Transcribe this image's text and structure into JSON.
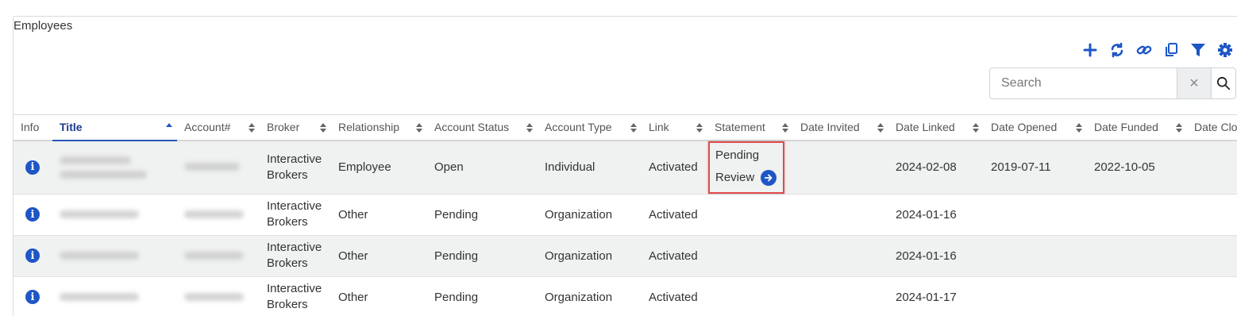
{
  "panel": {
    "title": "Employees"
  },
  "toolbar": {
    "icons": [
      "plus-icon",
      "refresh-icon",
      "link-icon",
      "copy-icon",
      "filter-icon",
      "gear-icon"
    ],
    "accent": "#1e56c6"
  },
  "search": {
    "placeholder": "Search",
    "clear": "×"
  },
  "table": {
    "columns": [
      "Info",
      "Title",
      "Account#",
      "Broker",
      "Relationship",
      "Account Status",
      "Account Type",
      "Link",
      "Statement",
      "Date Invited",
      "Date Linked",
      "Date Opened",
      "Date Funded",
      "Date Clo"
    ],
    "sorted_column": "Title",
    "rows": [
      {
        "broker": "Interactive Brokers",
        "relationship": "Employee",
        "status": "Open",
        "type": "Individual",
        "link": "Activated",
        "statement_line1": "Pending",
        "statement_line2": "Review",
        "date_invited": "",
        "date_linked": "2024-02-08",
        "date_opened": "2019-07-11",
        "date_funded": "2022-10-05"
      },
      {
        "broker": "Interactive Brokers",
        "relationship": "Other",
        "status": "Pending",
        "type": "Organization",
        "link": "Activated",
        "date_invited": "",
        "date_linked": "2024-01-16",
        "date_opened": "",
        "date_funded": ""
      },
      {
        "broker": "Interactive Brokers",
        "relationship": "Other",
        "status": "Pending",
        "type": "Organization",
        "link": "Activated",
        "date_invited": "",
        "date_linked": "2024-01-16",
        "date_opened": "",
        "date_funded": ""
      },
      {
        "broker": "Interactive Brokers",
        "relationship": "Other",
        "status": "Pending",
        "type": "Organization",
        "link": "Activated",
        "date_invited": "",
        "date_linked": "2024-01-17",
        "date_opened": "",
        "date_funded": ""
      }
    ]
  }
}
